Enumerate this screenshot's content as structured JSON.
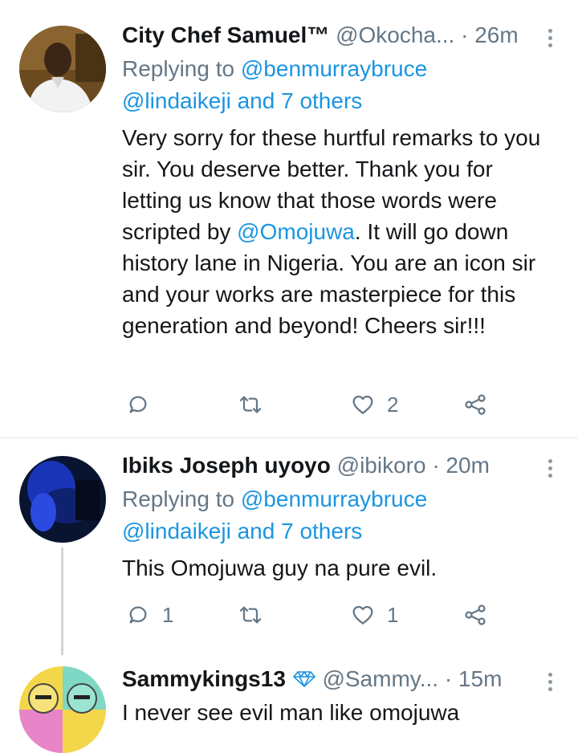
{
  "tweets": [
    {
      "name": "City Chef Samuel™",
      "handle": "@Okocha...",
      "time": "· 26m",
      "replying_prefix": "Replying to ",
      "replying_user": "@benmurraybruce",
      "replying_others": "@lindaikeji and 7 others",
      "text_a": "Very sorry for these hurtful remarks to you sir. You deserve better. Thank you for letting us know that those words were scripted by ",
      "text_mention": "@Omojuwa",
      "text_b": ". It will go down history lane in Nigeria. You are an icon sir and your works are masterpiece for this generation and beyond! Cheers sir!!!",
      "reply_count": "",
      "retweet_count": "",
      "like_count": "2"
    },
    {
      "name": "Ibiks Joseph uyoyo",
      "handle": "@ibikoro",
      "time": "· 20m",
      "replying_prefix": "Replying to ",
      "replying_user": "@benmurraybruce",
      "replying_others": "@lindaikeji and 7 others",
      "text": "This Omojuwa guy na pure evil.",
      "reply_count": "1",
      "retweet_count": "",
      "like_count": "1"
    },
    {
      "name": "Sammykings13",
      "handle": "@Sammy...",
      "time": "· 15m",
      "text": "I never see evil man like omojuwa"
    }
  ],
  "icons": {
    "reply": "reply-icon",
    "retweet": "retweet-icon",
    "like": "heart-icon",
    "share": "share-icon",
    "more": "more-vertical-icon",
    "badge": "diamond-icon"
  },
  "colors": {
    "link": "#1b95e0",
    "meta": "#657786",
    "text": "#14171a",
    "divider": "#e1e8ed"
  }
}
